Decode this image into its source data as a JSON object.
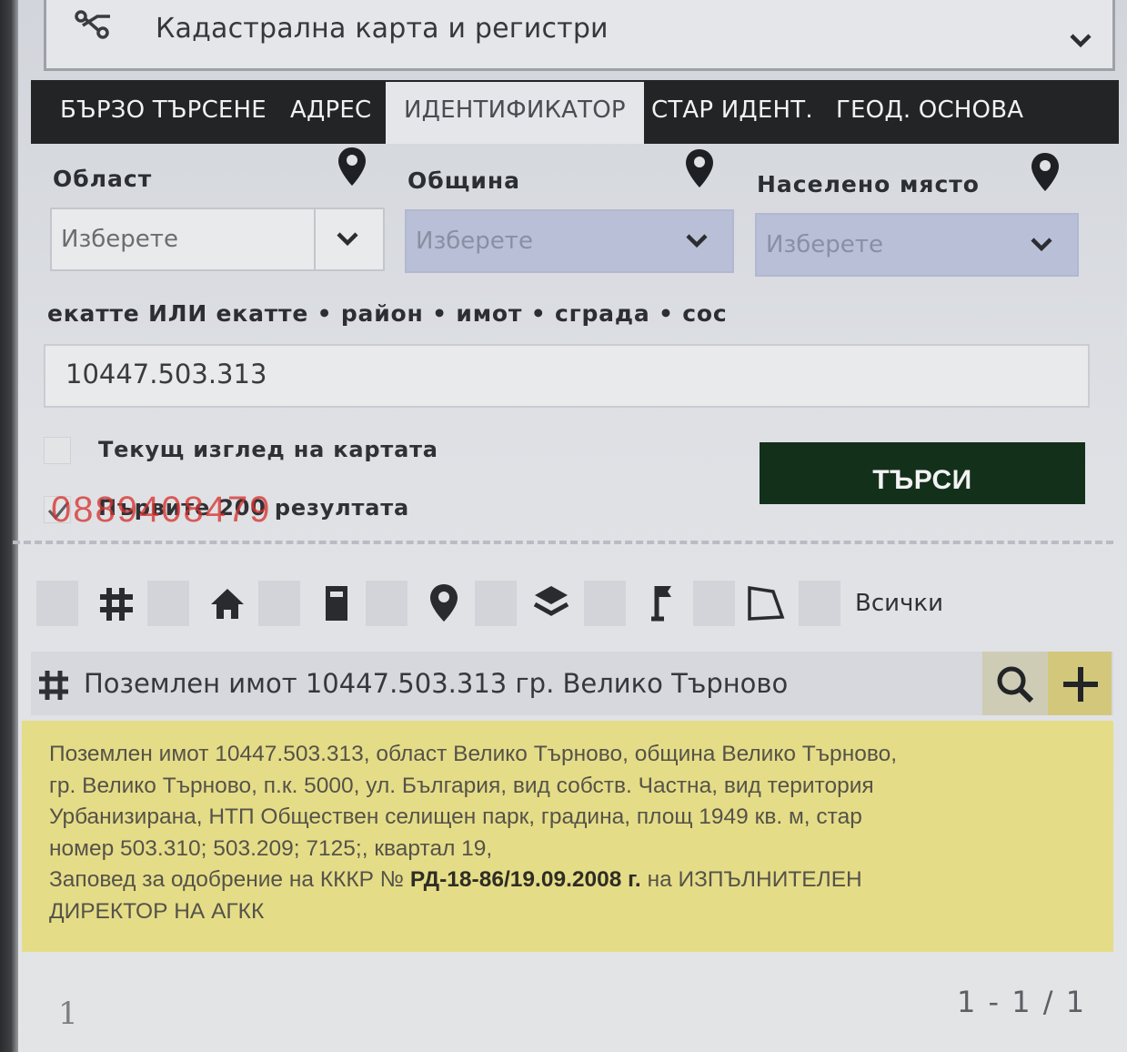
{
  "header": {
    "title": "Кадастрална карта и регистри",
    "logo_icon": "cadastre-logo-icon",
    "expand_icon": "chevron-down-icon"
  },
  "tabs": [
    {
      "label": "БЪРЗО ТЪРСЕНЕ",
      "active": false
    },
    {
      "label": "АДРЕС",
      "active": false
    },
    {
      "label": "ИДЕНТИФИКАТОР",
      "active": true
    },
    {
      "label": "СТАР ИДЕНТ.",
      "active": false
    },
    {
      "label": "ГЕОД. ОСНОВА",
      "active": false
    }
  ],
  "filters": {
    "region": {
      "label": "Област",
      "value": "Изберете",
      "icon": "map-pin-icon"
    },
    "municipality": {
      "label": "Община",
      "value": "Изберете",
      "icon": "map-pin-icon"
    },
    "settlement": {
      "label": "Населено място",
      "value": "Изберете",
      "icon": "map-pin-icon"
    }
  },
  "identifier": {
    "label": "екатте ИЛИ екатте • район • имот • сграда • сос",
    "value": "10447.503.313"
  },
  "options": {
    "current_view": {
      "label": "Текущ изглед на картата",
      "checked": false
    },
    "first_200": {
      "label": "Първите 200 резултата",
      "checked": true
    }
  },
  "search_button": "ТЪРСИ",
  "watermark": "0889408479",
  "type_filters": {
    "icons": [
      "land-grid-icon",
      "house-icon",
      "building-icon",
      "map-pin-icon",
      "layers-icon",
      "flag-icon",
      "polygon-icon"
    ],
    "all_label": "Всички"
  },
  "result": {
    "title": "Поземлен имот 10447.503.313 гр. Велико Търново",
    "lines": [
      "Поземлен имот 10447.503.313, област Велико Търново, община Велико Търново,",
      "гр. Велико Търново, п.к. 5000, ул. България, вид собств. Частна, вид територия",
      "Урбанизирана, НТП Обществен селищен парк, градина, площ 1949 кв. м, стар",
      "номер 503.310; 503.209; 7125;, квартал 19,"
    ],
    "order_prefix": "Заповед за одобрение на КККР №",
    "order_number": "РД-18-86/19.09.2008 г.",
    "order_suffix": "на ИЗПЪЛНИТЕЛЕН",
    "order_line2": "ДИРЕКТОР НА АГКК"
  },
  "pager": {
    "left": "1",
    "range": "1 - 1 / 1"
  },
  "colors": {
    "tab_bar": "#232426",
    "search_button": "#13301b",
    "info_box": "#e5dc88",
    "add_button": "#d3c77c",
    "disabled_select": "#b9bfd6"
  }
}
